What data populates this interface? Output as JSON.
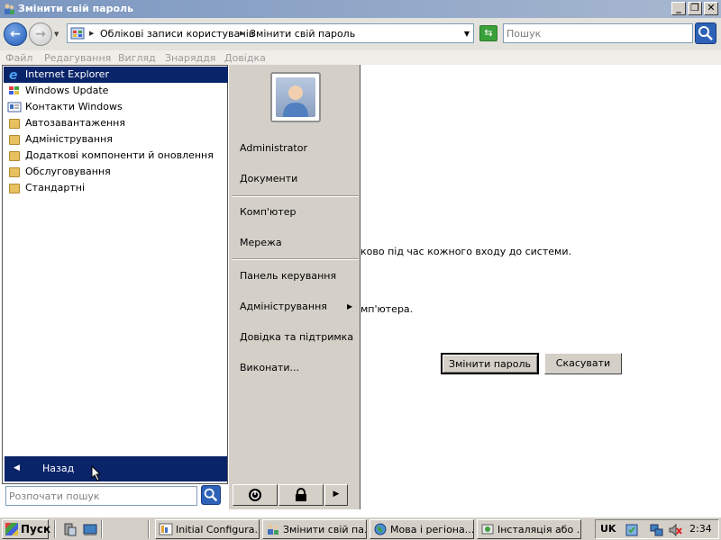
{
  "window": {
    "title": "Змінити свій пароль",
    "controls": {
      "minimize": "_",
      "restore": "❐",
      "close": "✕"
    }
  },
  "address_bar": {
    "crumbs": [
      "Облікові записи користувачів",
      "Змінити свій пароль"
    ],
    "search_placeholder": "Пошук"
  },
  "menu": [
    "Файл",
    "Редагування",
    "Вигляд",
    "Знаряддя",
    "Довідка"
  ],
  "start_menu": {
    "programs": [
      {
        "label": "Internet Explorer",
        "icon": "ie-icon",
        "selected": true
      },
      {
        "label": "Windows Update",
        "icon": "windows-update-icon"
      },
      {
        "label": "Контакти Windows",
        "icon": "contacts-icon"
      },
      {
        "label": "Автозавантаження",
        "icon": "folder-icon"
      },
      {
        "label": "Адміністрування",
        "icon": "folder-icon"
      },
      {
        "label": "Додаткові компоненти й оновлення",
        "icon": "folder-icon"
      },
      {
        "label": "Обслуговування",
        "icon": "folder-icon"
      },
      {
        "label": "Стандартні",
        "icon": "folder-icon"
      }
    ],
    "back_label": "Назад",
    "search_placeholder": "Розпочати пошук",
    "right_items": {
      "user": "Administrator",
      "documents": "Документи",
      "computer": "Комп'ютер",
      "network": "Мережа",
      "control_panel": "Панель керування",
      "admin_tools": "Адміністрування",
      "help": "Довідка та підтримка",
      "run": "Виконати..."
    }
  },
  "content": {
    "line1": "ково під час кожного входу до системи.",
    "line2": "мп'ютера.",
    "change_password_button": "Змінити пароль",
    "cancel_button": "Скасувати"
  },
  "taskbar": {
    "start_label": "Пуск",
    "tasks": [
      {
        "label": "Initial Configura...",
        "icon": "config-icon"
      },
      {
        "label": "Змінити свій па...",
        "icon": "users-icon"
      },
      {
        "label": "Мова і регіона...",
        "icon": "globe-icon"
      },
      {
        "label": "Інсталяція або ...",
        "icon": "install-icon"
      }
    ],
    "language": "UK",
    "clock": "2:34"
  }
}
